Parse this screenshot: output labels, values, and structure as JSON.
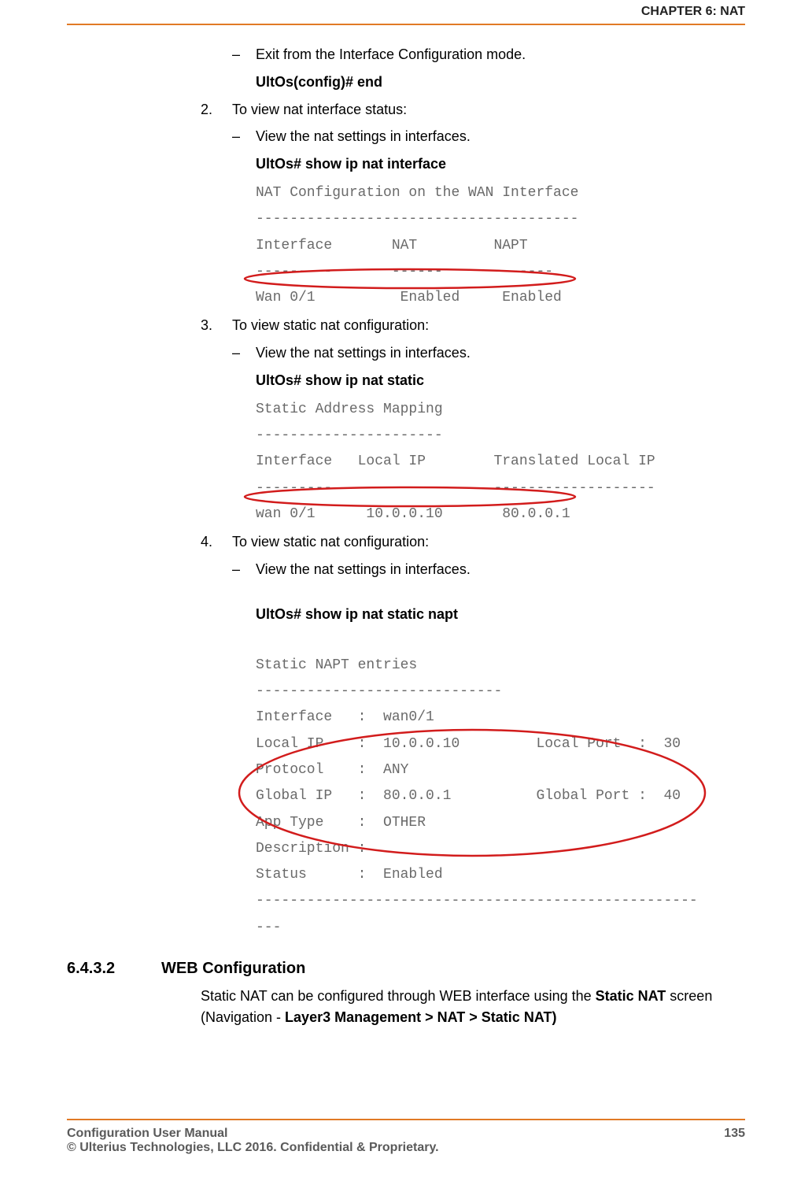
{
  "header": "CHAPTER 6: NAT",
  "items": [
    {
      "kind": "dash",
      "text": "Exit from the Interface Configuration mode."
    },
    {
      "kind": "cmd",
      "text": "UltOs(config)# end"
    },
    {
      "kind": "num",
      "num": "2.",
      "text": "To view nat interface status:"
    },
    {
      "kind": "dash",
      "text": "View the nat settings in interfaces."
    },
    {
      "kind": "cmd",
      "text": "UltOs# show ip nat interface"
    },
    {
      "kind": "code",
      "id": "code1",
      "text": "NAT Configuration on the WAN Interface\n--------------------------------------\nInterface       NAT         NAPT\n---------       ------      -------\nWan 0/1          Enabled     Enabled"
    },
    {
      "kind": "num",
      "num": "3.",
      "text": "To view static nat configuration:"
    },
    {
      "kind": "dash",
      "text": "View the nat settings in interfaces."
    },
    {
      "kind": "cmd",
      "text": "UltOs# show ip nat static"
    },
    {
      "kind": "code",
      "id": "code2",
      "text": "Static Address Mapping\n----------------------\nInterface   Local IP        Translated Local IP\n---------   ---------       -------------------\nwan 0/1      10.0.0.10       80.0.0.1"
    },
    {
      "kind": "num",
      "num": "4.",
      "text": "To view static nat configuration:"
    },
    {
      "kind": "dash",
      "text": "View the nat settings in interfaces."
    },
    {
      "kind": "spacer"
    },
    {
      "kind": "cmd",
      "text": "UltOs# show ip nat static napt"
    },
    {
      "kind": "spacer"
    },
    {
      "kind": "code",
      "id": "code3",
      "text": "Static NAPT entries\n-----------------------------\nInterface   :  wan0/1\nLocal IP    :  10.0.0.10         Local Port  :  30\nProtocol    :  ANY\nGlobal IP   :  80.0.0.1          Global Port :  40\nApp Type    :  OTHER\nDescription :\nStatus      :  Enabled\n----------------------------------------------------\n---"
    }
  ],
  "section": {
    "num": "6.4.3.2",
    "title": "WEB Configuration"
  },
  "body_parts": {
    "p1": "Static NAT can be configured through WEB interface using the ",
    "b1": "Static NAT",
    "p2": " screen (Navigation - ",
    "b2": "Layer3 Management > NAT > Static NAT)",
    "p3": ""
  },
  "footer": {
    "left1": "Configuration User Manual",
    "left2": "© Ulterius Technologies, LLC 2016. Confidential & Proprietary.",
    "page": "135"
  }
}
